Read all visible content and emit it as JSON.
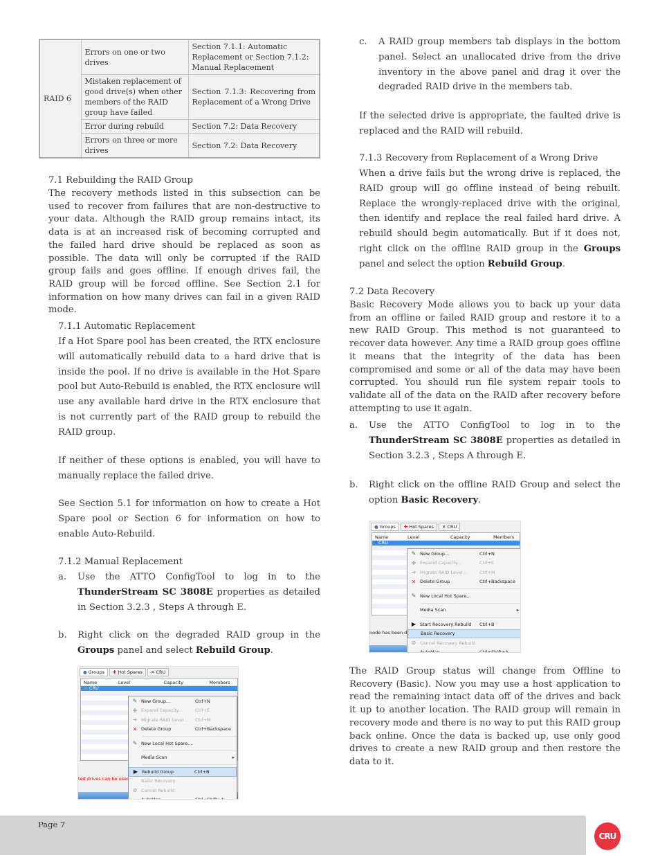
{
  "table": {
    "group": "RAID 6",
    "rows": [
      {
        "error": "Errors on one or two drives",
        "ref": "Section 7.1.1: Automatic Replacement or Section 7.1.2: Manual Replacement"
      },
      {
        "error": "Mistaken replacement of good drive(s) when other members of the RAID group have failed",
        "ref": "Section 7.1.3: Recovering from Replacement of a Wrong Drive"
      },
      {
        "error": "Error during rebuild",
        "ref": "Section 7.2: Data Recovery"
      },
      {
        "error": "Errors on three or more drives",
        "ref": "Section 7.2: Data Recovery"
      }
    ]
  },
  "s71": {
    "heading": "7.1 Rebuilding the RAID Group",
    "body": "The recovery methods listed in this subsection can be used to recover from failures that are non-destructive to your data. Although the RAID group remains intact, its data is at an increased risk of becoming corrupted and the failed hard drive should be replaced as soon as possible. The data will only be corrupted if the RAID group fails and goes offline. If enough drives fail, the RAID group will be forced offline. See Section 2.1  for information on how many drives can fail in a given RAID mode."
  },
  "s711": {
    "heading": "7.1.1 Automatic Replacement",
    "p1": "If a Hot Spare pool has been created, the RTX enclosure will automatically rebuild data to a hard drive that is inside the pool. If no drive is available in the Hot Spare pool but Auto-Rebuild is enabled, the RTX enclosure will use any available hard drive in the RTX enclosure that is not currently part of the RAID group to rebuild the RAID group.",
    "p2": "If neither of these options is enabled, you will have to manually replace the failed drive.",
    "p3": "See Section 5.1  for information on how to create a Hot Spare pool or Section 6  for information on how to enable Auto-Rebuild."
  },
  "s712": {
    "heading": "7.1.2 Manual Replacement",
    "a_label": "a.",
    "a_pre": "Use the ATTO ConfigTool to log in to the ",
    "a_bold": "ThunderStream SC 3808E",
    "a_post": " properties as detailed in Section 3.2.3 , Steps A through E.",
    "b_label": "b.",
    "b_pre": "Right click on the degraded RAID group in the ",
    "b_bold1": "Groups",
    "b_mid": " panel and select ",
    "b_bold2": "Rebuild Group",
    "b_post": ".",
    "c_label": "c.",
    "c_text": "A RAID group members tab displays in the bottom panel. Select an unallocated drive from the drive inventory in the above panel and drag it over the degraded RAID drive in the members tab.",
    "after": "If the selected drive is appropriate, the faulted drive is replaced and the RAID will rebuild."
  },
  "s713": {
    "heading": "7.1.3 Recovery from Replacement of a Wrong Drive",
    "pre": "When a drive fails but the wrong drive is replaced, the RAID group will go offline instead of being rebuilt. Replace the wrongly-replaced drive with the original, then identify and replace the real failed hard drive. A rebuild should begin automatically. But if it does not, right click on the offline RAID group in the ",
    "bold1": "Groups",
    "mid": " panel and select the option ",
    "bold2": "Rebuild Group",
    "post": "."
  },
  "s72": {
    "heading": "7.2 Data Recovery",
    "body": "Basic Recovery Mode allows you to back up your data from an offline or failed RAID group and restore it to a new RAID Group. This method is not guaranteed to recover data however. Any time a RAID group goes offline it means that the integrity of the data has been compromised and some or all of the data may have been corrupted. You should run file system repair tools to validate all of the data on the RAID after recovery before attempting to use it again.",
    "a_label": "a.",
    "a_pre": "Use the ATTO ConfigTool to log in to the ",
    "a_bold": "ThunderStream SC 3808E",
    "a_post": " properties as detailed in Section 3.2.3 , Steps A through E.",
    "b_label": "b.",
    "b_pre": "Right click on the offline RAID Group and select the option ",
    "b_bold": "Basic Recovery",
    "b_post": ".",
    "after": "The RAID Group status will change from Offline to Recovery (Basic). Now you may use a host application to read the remaining intact data off of the drives and back it up to another location. The RAID group will remain in recovery mode and there is no way to put this RAID group back online. Once the data is backed up, use only good drives to create a new RAID group and then restore the data to it."
  },
  "shot1": {
    "tabs": [
      "Groups",
      "Hot Spares",
      "CRU"
    ],
    "columns": [
      "Name",
      "Level",
      "Capacity",
      "Members"
    ],
    "row": "CRU",
    "status_icon": "warning-icon",
    "red_text": "ted drives can be used a",
    "menu": [
      {
        "label": "New Group...",
        "shortcut": "Ctrl+N",
        "icon": "wand-icon"
      },
      {
        "label": "Expand Capacity...",
        "shortcut": "Ctrl+E",
        "icon": "plus-icon",
        "disabled": true
      },
      {
        "label": "Migrate RAID Level...",
        "shortcut": "Ctrl+M",
        "icon": "arrow-icon",
        "disabled": true
      },
      {
        "label": "Delete Group",
        "shortcut": "Ctrl+Backspace",
        "icon": "red-x-icon"
      },
      {
        "label": "New Local Hot Spare...",
        "shortcut": "",
        "icon": "wand-icon"
      },
      {
        "label": "Media Scan",
        "shortcut": "",
        "submenu": true
      },
      {
        "label": "Rebuild Group",
        "shortcut": "Ctrl+B",
        "icon": "play-icon",
        "highlight": true
      },
      {
        "label": "Basic Recovery",
        "shortcut": "",
        "disabled": true
      },
      {
        "label": "Cancel Rebuild",
        "shortcut": "",
        "icon": "cancel-icon",
        "disabled": true
      },
      {
        "label": "AutoMap",
        "shortcut": "Ctrl+Shift+A"
      }
    ]
  },
  "shot2": {
    "tabs": [
      "Groups",
      "Hot Spares",
      "CRU"
    ],
    "columns": [
      "Name",
      "Level",
      "Capacity",
      "Members"
    ],
    "row": "CRU",
    "status_icon": "error-icon",
    "gray_text": "node has been dis",
    "menu": [
      {
        "label": "New Group...",
        "shortcut": "Ctrl+N",
        "icon": "wand-icon"
      },
      {
        "label": "Expand Capacity...",
        "shortcut": "Ctrl+E",
        "icon": "plus-icon",
        "disabled": true
      },
      {
        "label": "Migrate RAID Level...",
        "shortcut": "Ctrl+M",
        "icon": "arrow-icon",
        "disabled": true
      },
      {
        "label": "Delete Group",
        "shortcut": "Ctrl+Backspace",
        "icon": "red-x-icon"
      },
      {
        "label": "New Local Hot Spare...",
        "shortcut": "",
        "icon": "wand-icon"
      },
      {
        "label": "Media Scan",
        "shortcut": "",
        "submenu": true
      },
      {
        "label": "Start Recovery Rebuild",
        "shortcut": "Ctrl+B",
        "icon": "play-icon"
      },
      {
        "label": "Basic Recovery",
        "shortcut": "",
        "highlight": true
      },
      {
        "label": "Cancel Recovery Rebuild",
        "shortcut": "",
        "icon": "cancel-icon",
        "disabled": true
      },
      {
        "label": "AutoMap",
        "shortcut": "Ctrl+Shift+A"
      }
    ]
  },
  "footer": {
    "page": "Page 7",
    "logo": "CRU"
  },
  "colors": {
    "logo": "#e8343f",
    "footer": "#d3d3d3",
    "selection": "#3d8ee6"
  }
}
